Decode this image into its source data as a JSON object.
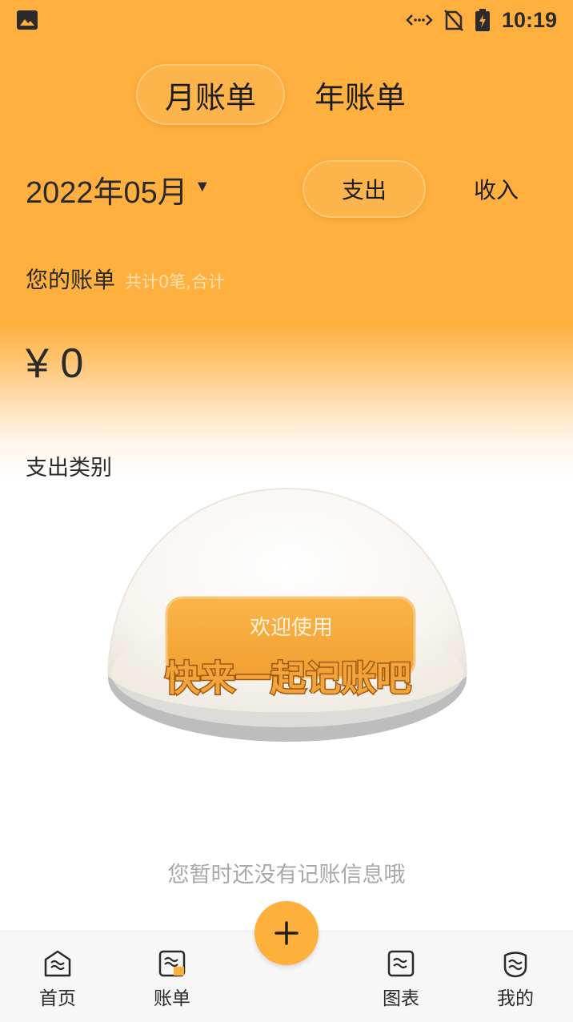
{
  "status_bar": {
    "time": "10:19"
  },
  "tabs": {
    "monthly": "月账单",
    "yearly": "年账单"
  },
  "month_picker": {
    "value": "2022年05月"
  },
  "type_toggle": {
    "expense": "支出",
    "income": "收入"
  },
  "bill_summary": {
    "title": "您的账单",
    "subtitle": "共计0笔,合计",
    "amount": "¥ 0"
  },
  "category": {
    "title": "支出类别"
  },
  "illustration": {
    "line1": "欢迎使用",
    "line2": "快来一起记账吧"
  },
  "empty_state": {
    "text": "您暂时还没有记账信息哦"
  },
  "bottom_nav": {
    "items": [
      {
        "label": "首页",
        "icon": "home-icon"
      },
      {
        "label": "账单",
        "icon": "bill-icon"
      },
      {
        "label": "图表",
        "icon": "chart-icon"
      },
      {
        "label": "我的",
        "icon": "profile-icon"
      }
    ],
    "fab_icon": "plus-icon"
  },
  "colors": {
    "accent": "#ffb03f",
    "fab": "#fdb03c",
    "text_muted": "#a8a8a8"
  }
}
